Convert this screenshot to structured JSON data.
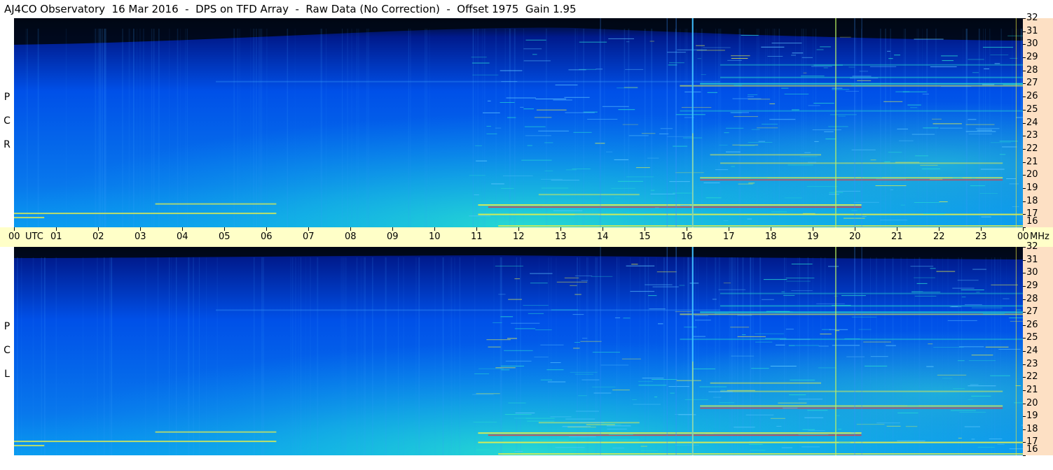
{
  "title": "AJ4CO Observatory  16 Mar 2016  -  DPS on TFD Array  -  Raw Data (No Correction)  -  Offset 1975  Gain 1.95",
  "chart_data": [
    {
      "type": "heatmap",
      "panel": "RCP",
      "side_label": [
        "R",
        "C",
        "P"
      ],
      "x_axis": {
        "unit": "UTC",
        "range": [
          0,
          24
        ]
      },
      "y_axis": {
        "unit": "MHz",
        "range": [
          16,
          32
        ]
      },
      "colormap": [
        "#000814",
        "#001a8c",
        "#0050e8",
        "#0a9cf0",
        "#28dcd0",
        "#e6f04a",
        "#ff2a2a"
      ]
    },
    {
      "type": "heatmap",
      "panel": "LCP",
      "side_label": [
        "L",
        "C",
        "P"
      ],
      "x_axis": {
        "unit": "UTC",
        "range": [
          0,
          24
        ]
      },
      "y_axis": {
        "unit": "MHz",
        "range": [
          16,
          32
        ]
      },
      "colormap": [
        "#000814",
        "#001a8c",
        "#0050e8",
        "#0a9cf0",
        "#28dcd0",
        "#e6f04a",
        "#ff2a2a"
      ]
    }
  ],
  "time_axis": {
    "labels": [
      "00",
      "UTC",
      "01",
      "02",
      "03",
      "04",
      "05",
      "06",
      "07",
      "08",
      "09",
      "10",
      "11",
      "12",
      "13",
      "14",
      "15",
      "16",
      "17",
      "18",
      "19",
      "20",
      "21",
      "22",
      "23",
      "00",
      "MHz"
    ]
  },
  "freq_axis": {
    "labels": [
      "32",
      "31",
      "30",
      "29",
      "28",
      "27",
      "26",
      "25",
      "24",
      "23",
      "22",
      "21",
      "20",
      "19",
      "18",
      "17",
      "16"
    ]
  }
}
